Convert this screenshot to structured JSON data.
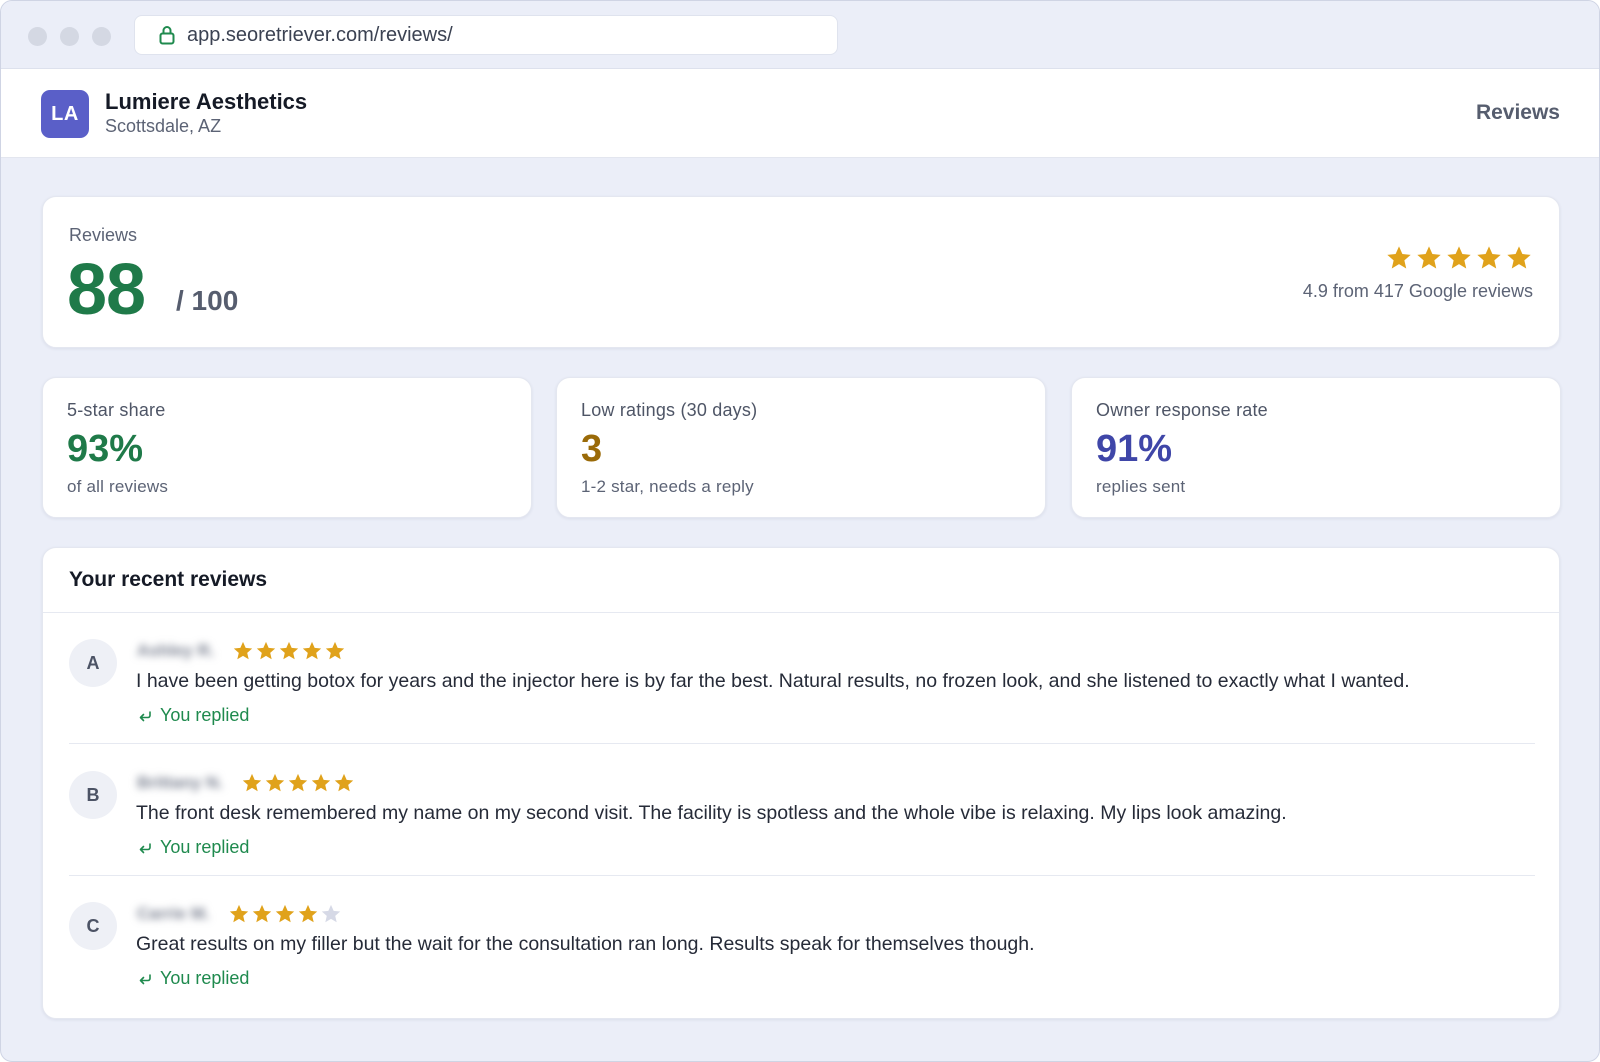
{
  "browser": {
    "url": "app.seoretriever.com/reviews/"
  },
  "header": {
    "logo_initials": "LA",
    "business_name": "Lumiere Aesthetics",
    "location": "Scottsdale, AZ",
    "nav_label": "Reviews"
  },
  "score": {
    "label": "Reviews",
    "value": "88",
    "out_of": "/ 100",
    "stars": 5,
    "rating_text": "4.9 from 417 Google reviews"
  },
  "stats": [
    {
      "label": "5-star share",
      "value": "93%",
      "sub": "of all reviews",
      "color": "#1f7a49"
    },
    {
      "label": "Low ratings (30 days)",
      "value": "3",
      "sub": "1-2 star, needs a reply",
      "color": "#9a6a08"
    },
    {
      "label": "Owner response rate",
      "value": "91%",
      "sub": "replies sent",
      "color": "#3f46a8"
    }
  ],
  "recent_reviews": {
    "title": "Your recent reviews",
    "items": [
      {
        "initial": "A",
        "name": "Ashley R.",
        "rating": 5,
        "text": "I have been getting botox for years and the injector here is by far the best. Natural results, no frozen look, and she listened to exactly what I wanted.",
        "reply_status": "You replied"
      },
      {
        "initial": "B",
        "name": "Brittany N.",
        "rating": 5,
        "text": "The front desk remembered my name on my second visit. The facility is spotless and the whole vibe is relaxing. My lips look amazing.",
        "reply_status": "You replied"
      },
      {
        "initial": "C",
        "name": "Carrie M.",
        "rating": 4,
        "text": "Great results on my filler but the wait for the consultation ran long. Results speak for themselves though.",
        "reply_status": "You replied"
      }
    ]
  },
  "colors": {
    "star_filled": "#e0a21b",
    "star_empty": "#d6d9e6",
    "brand": "#5a5fc8",
    "success": "#1f8a4e"
  }
}
